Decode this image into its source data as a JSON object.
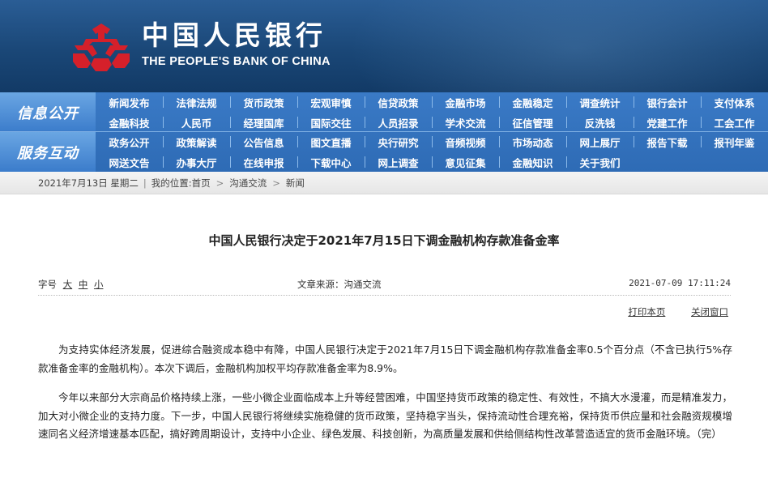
{
  "header": {
    "brand_cn": "中国人民银行",
    "brand_en": "THE PEOPLE'S BANK OF CHINA",
    "logo_icon": "pboc-emblem-icon",
    "colors": {
      "banner": "#1a4777",
      "logo": "#d5202a",
      "nav": "#2e6bb5"
    }
  },
  "nav": {
    "section1_label": "信息公开",
    "section2_label": "服务互动",
    "row1": [
      "新闻发布",
      "法律法规",
      "货币政策",
      "宏观审慎",
      "信贷政策",
      "金融市场",
      "金融稳定",
      "调查统计",
      "银行会计",
      "支付体系"
    ],
    "row2": [
      "金融科技",
      "人民币",
      "经理国库",
      "国际交往",
      "人员招录",
      "学术交流",
      "征信管理",
      "反洗钱",
      "党建工作",
      "工会工作"
    ],
    "row3": [
      "政务公开",
      "政策解读",
      "公告信息",
      "图文直播",
      "央行研究",
      "音频视频",
      "市场动态",
      "网上展厅",
      "报告下载",
      "报刊年鉴"
    ],
    "row4": [
      "网送文告",
      "办事大厅",
      "在线申报",
      "下载中心",
      "网上调查",
      "意见征集",
      "金融知识",
      "关于我们"
    ]
  },
  "breadcrumb": {
    "date": "2021年7月13日 星期二",
    "location_label": "我的位置:",
    "home": "首页",
    "level1": "沟通交流",
    "level2": "新闻"
  },
  "article": {
    "title": "中国人民银行决定于2021年7月15日下调金融机构存款准备金率",
    "font_size_label": "字号",
    "size_large": "大",
    "size_medium": "中",
    "size_small": "小",
    "source": "文章来源：沟通交流",
    "datetime": "2021-07-09 17:11:24",
    "print_label": "打印本页",
    "close_label": "关闭窗口",
    "paragraphs": [
      "为支持实体经济发展，促进综合融资成本稳中有降，中国人民银行决定于2021年7月15日下调金融机构存款准备金率0.5个百分点（不含已执行5%存款准备金率的金融机构）。本次下调后，金融机构加权平均存款准备金率为8.9%。",
      "今年以来部分大宗商品价格持续上涨，一些小微企业面临成本上升等经营困难，中国坚持货币政策的稳定性、有效性，不搞大水漫灌，而是精准发力，加大对小微企业的支持力度。下一步，中国人民银行将继续实施稳健的货币政策，坚持稳字当头，保持流动性合理充裕，保持货币供应量和社会融资规模增速同名义经济增速基本匹配，搞好跨周期设计，支持中小企业、绿色发展、科技创新，为高质量发展和供给侧结构性改革营造适宜的货币金融环境。（完）"
    ]
  }
}
